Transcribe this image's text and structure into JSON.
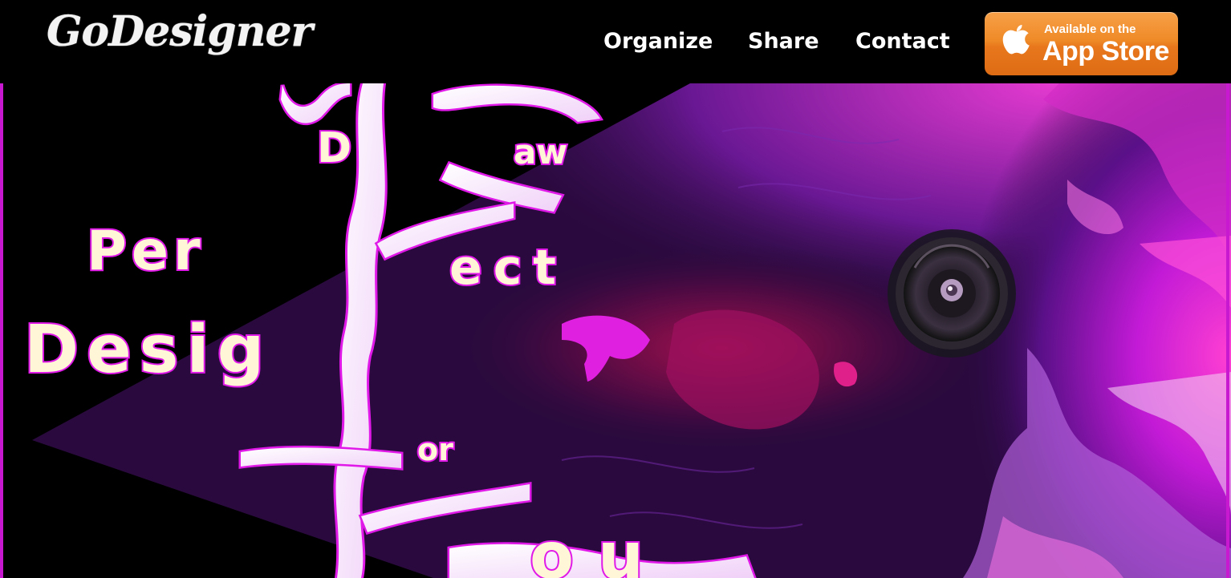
{
  "header": {
    "logo_text": "GoDesigner",
    "nav": [
      {
        "label": "Organize"
      },
      {
        "label": "Share"
      },
      {
        "label": "Contact"
      }
    ],
    "app_store_badge": {
      "small_text": "Available on the",
      "big_text": "App Store",
      "icon": "apple-icon",
      "color": "#ef8a27"
    }
  },
  "hero": {
    "art_text": [
      "We",
      "Draw",
      "Perfect",
      "Design",
      "For",
      "You"
    ],
    "accent_color": "#e018e8",
    "background_color": "#2a0a3e"
  }
}
